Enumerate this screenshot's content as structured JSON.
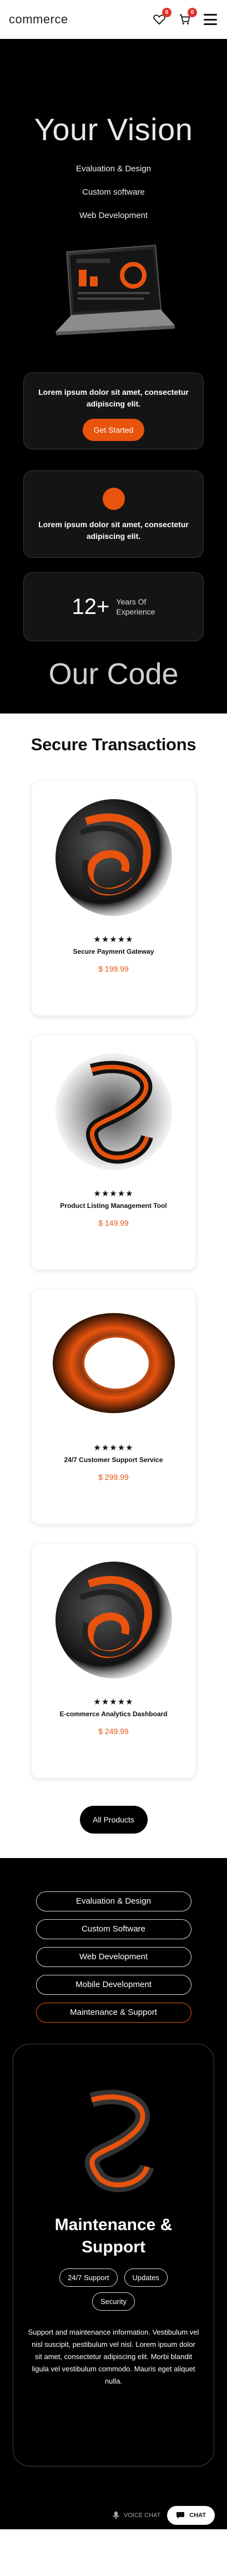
{
  "header": {
    "logo": "commerce",
    "wishlist_count": "0",
    "cart_count": "0",
    "icons": [
      "heart-icon",
      "cart-icon",
      "menu-icon"
    ]
  },
  "hero": {
    "title": "Your Vision",
    "services": [
      "Evaluation & Design",
      "Custom software",
      "Web Development"
    ],
    "card1_text": "Lorem ipsum dolor sit amet, consectetur adipiscing elit.",
    "card1_button": "Get Started",
    "card2_text": "Lorem ipsum dolor sit amet, consectetur adipiscing elit.",
    "years_number": "12+",
    "years_label_1": "Years Of",
    "years_label_2": "Experience",
    "code_title": "Our Code"
  },
  "secure": {
    "title": "Secure Transactions",
    "stars": "★★★★★",
    "products": [
      {
        "name": "Secure Payment Gateway",
        "price": "$ 199.99"
      },
      {
        "name": "Product Listing Management Tool",
        "price": "$ 149.99"
      },
      {
        "name": "24/7 Customer Support Service",
        "price": "$ 299.99"
      },
      {
        "name": "E-commerce Analytics Dashboard",
        "price": "$ 249.99"
      }
    ],
    "all_button": "All Products"
  },
  "bottom": {
    "pills": [
      "Evaluation & Design",
      "Custom Software",
      "Web Development",
      "Mobile Development",
      "Maintenance & Support"
    ],
    "detail_title_1": "Maintenance &",
    "detail_title_2": "Support",
    "tags": [
      "24/7 Support",
      "Updates",
      "Security"
    ],
    "detail_text": "Support and maintenance information. Vestibulum vel nisl suscipit, pestibulum vel nisl. Lorem ipsum dolor sit amet, consectetur adipiscing elit. Morbi blandit ligula vel vestibulum commodo. Mauris eget aliquet nulla.",
    "voice_label": "VOICE CHAT",
    "chat_label": "CHAT"
  },
  "colors": {
    "accent": "#e8530e",
    "badge": "#e0322d",
    "dark": "#000000"
  }
}
